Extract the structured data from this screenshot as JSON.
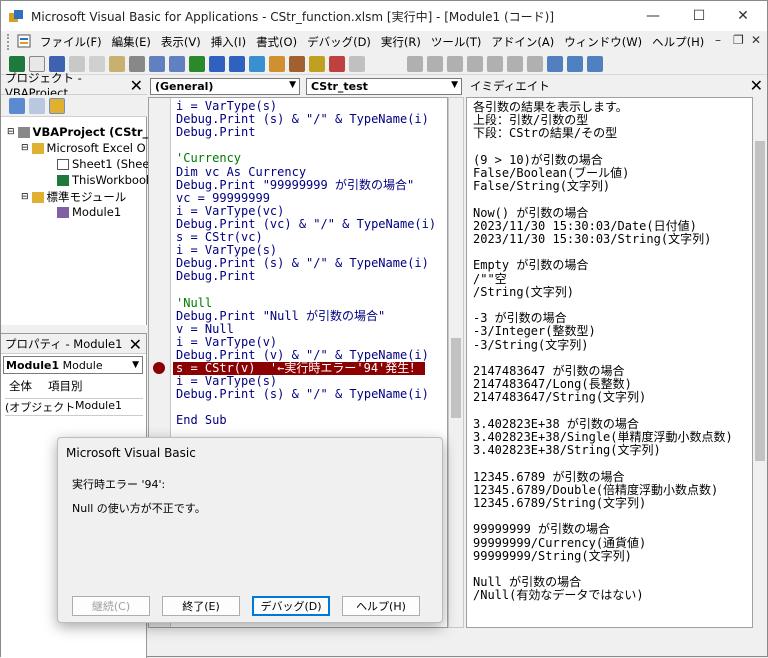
{
  "window": {
    "title": "Microsoft Visual Basic for Applications - CStr_function.xlsm [実行中] - [Module1 (コード)]"
  },
  "menu": [
    "ファイル(F)",
    "編集(E)",
    "表示(V)",
    "挿入(I)",
    "書式(O)",
    "デバッグ(D)",
    "実行(R)",
    "ツール(T)",
    "アドイン(A)",
    "ウィンドウ(W)",
    "ヘルプ(H)"
  ],
  "project": {
    "title": "プロジェクト - VBAProject",
    "items": [
      "VBAProject (CStr_",
      "Microsoft Excel O",
      "Sheet1 (Shee",
      "ThisWorkbook",
      "標準モジュール",
      "Module1"
    ]
  },
  "properties": {
    "title": "プロパティ - Module1",
    "object": "Module1",
    "object_type": "Module",
    "tabs": [
      "全体",
      "項目別"
    ],
    "row_name": "(オブジェクト名)",
    "row_value": "Module1"
  },
  "code": {
    "object_combo": "(General)",
    "proc_combo": "CStr_test",
    "lines": [
      {
        "t": "i = VarType(s)",
        "k": ""
      },
      {
        "t": "Debug.Print (s) & \"/\" & TypeName(i)",
        "k": ""
      },
      {
        "t": "Debug.Print",
        "k": ""
      },
      {
        "t": "",
        "k": ""
      },
      {
        "t": "'Currency",
        "k": "c"
      },
      {
        "t": "Dim vc As Currency",
        "k": ""
      },
      {
        "t": "Debug.Print \"99999999 が引数の場合\"",
        "k": ""
      },
      {
        "t": "vc = 99999999",
        "k": ""
      },
      {
        "t": "i = VarType(vc)",
        "k": ""
      },
      {
        "t": "Debug.Print (vc) & \"/\" & TypeName(i)",
        "k": ""
      },
      {
        "t": "s = CStr(vc)",
        "k": ""
      },
      {
        "t": "i = VarType(s)",
        "k": ""
      },
      {
        "t": "Debug.Print (s) & \"/\" & TypeName(i)",
        "k": ""
      },
      {
        "t": "Debug.Print",
        "k": ""
      },
      {
        "t": "",
        "k": ""
      },
      {
        "t": "'Null",
        "k": "c"
      },
      {
        "t": "Debug.Print \"Null が引数の場合\"",
        "k": ""
      },
      {
        "t": "v = Null",
        "k": ""
      },
      {
        "t": "i = VarType(v)",
        "k": ""
      },
      {
        "t": "Debug.Print (v) & \"/\" & TypeName(i)",
        "k": ""
      },
      {
        "t": "s = CStr(v)  '←実行時エラー'94'発生！",
        "k": "err"
      },
      {
        "t": "i = VarType(s)",
        "k": ""
      },
      {
        "t": "Debug.Print (s) & \"/\" & TypeName(i)",
        "k": ""
      },
      {
        "t": "",
        "k": ""
      },
      {
        "t": "End Sub",
        "k": ""
      }
    ]
  },
  "immediate": {
    "title": "イミディエイト",
    "lines": [
      "各引数の結果を表示します。",
      "上段：引数/引数の型",
      "下段：CStrの結果/その型",
      "",
      "(9 > 10)が引数の場合",
      "False/Boolean(ブール値)",
      "False/String(文字列)",
      "",
      "Now() が引数の場合",
      "2023/11/30 15:30:03/Date(日付値)",
      "2023/11/30 15:30:03/String(文字列)",
      "",
      "Empty が引数の場合",
      "/\"\"空",
      "/String(文字列)",
      "",
      "-3 が引数の場合",
      "-3/Integer(整数型)",
      "-3/String(文字列)",
      "",
      "2147483647 が引数の場合",
      "2147483647/Long(長整数)",
      "2147483647/String(文字列)",
      "",
      "3.402823E+38 が引数の場合",
      "3.402823E+38/Single(単精度浮動小数点数)",
      "3.402823E+38/String(文字列)",
      "",
      "12345.6789 が引数の場合",
      "12345.6789/Double(倍精度浮動小数点数)",
      "12345.6789/String(文字列)",
      "",
      "99999999 が引数の場合",
      "99999999/Currency(通貨値)",
      "99999999/String(文字列)",
      "",
      "Null が引数の場合",
      "/Null(有効なデータではない)"
    ]
  },
  "dialog": {
    "title": "Microsoft Visual Basic",
    "error": "実行時エラー '94':",
    "message": "Null の使い方が不正です。",
    "buttons": [
      "継続(C)",
      "終了(E)",
      "デバッグ(D)",
      "ヘルプ(H)"
    ]
  }
}
